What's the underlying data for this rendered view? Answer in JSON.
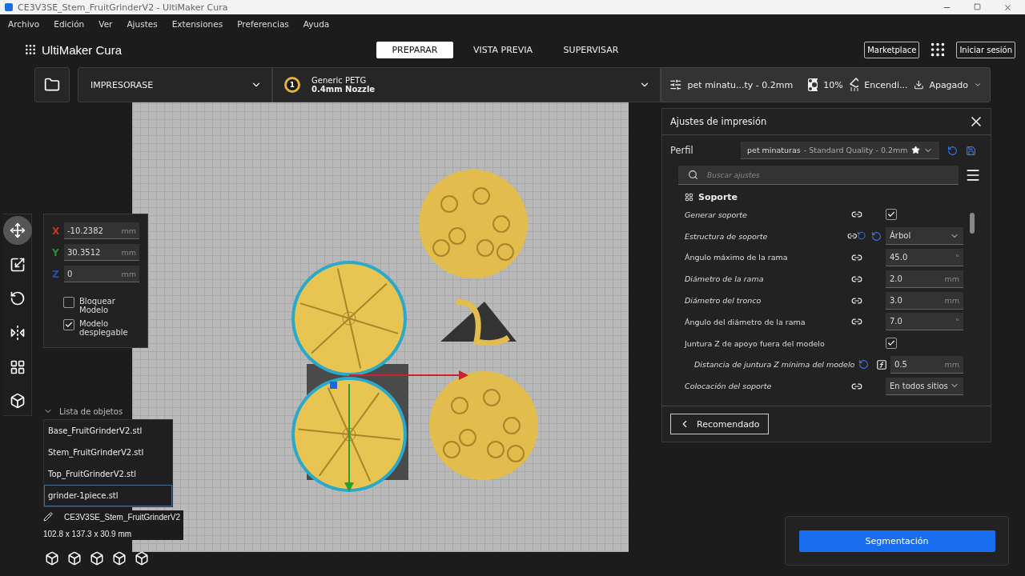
{
  "window": {
    "title": "CE3V3SE_Stem_FruitGrinderV2 - UltiMaker Cura"
  },
  "menu": [
    "Archivo",
    "Edición",
    "Ver",
    "Ajustes",
    "Extensiones",
    "Preferencias",
    "Ayuda"
  ],
  "header": {
    "logo": "UltiMaker Cura",
    "tabs": [
      {
        "label": "PREPARAR",
        "selected": true
      },
      {
        "label": "VISTA PREVIA",
        "selected": false
      },
      {
        "label": "SUPERVISAR",
        "selected": false
      }
    ],
    "marketplace": "Marketplace",
    "login": "Iniciar sesión"
  },
  "printer_bar": {
    "printer": "IMPRESORASE",
    "extruder": {
      "number": "1",
      "material": "Generic PETG",
      "nozzle": "0.4mm Nozzle"
    },
    "profile": "pet minatu...ty - 0.2mm",
    "infill": "10%",
    "support": "Encendi...",
    "adhesion": "Apagado"
  },
  "tools": [
    {
      "kind": "move",
      "selected": true
    },
    {
      "kind": "scale",
      "selected": false
    },
    {
      "kind": "rotate",
      "selected": false
    },
    {
      "kind": "mirror",
      "selected": false
    },
    {
      "kind": "per_model",
      "selected": false
    },
    {
      "kind": "support_blocker",
      "selected": false
    }
  ],
  "move_panel": {
    "fields": [
      {
        "axis": "X",
        "value": "-10.2382",
        "unit": "mm",
        "color": "#c0392b"
      },
      {
        "axis": "Y",
        "value": "30.3512",
        "unit": "mm",
        "color": "#2e8b3a"
      },
      {
        "axis": "Z",
        "value": "0",
        "unit": "mm",
        "color": "#2d4fa8"
      }
    ],
    "checkboxes": [
      {
        "label": "Bloquear Modelo",
        "checked": false
      },
      {
        "label": "Modelo desplegable",
        "checked": true
      }
    ]
  },
  "object_list": {
    "title": "Lista de objetos",
    "expanded": true,
    "items": [
      {
        "name": "Base_FruitGrinderV2.stl",
        "selected": false
      },
      {
        "name": "Stem_FruitGrinderV2.stl",
        "selected": false
      },
      {
        "name": "Top_FruitGrinderV2.stl",
        "selected": false
      },
      {
        "name": "grinder-1piece.stl",
        "selected": true
      }
    ]
  },
  "model_info": {
    "name": "CE3V3SE_Stem_FruitGrinderV2",
    "dimensions": "102.8 x 137.3 x 30.9 mm"
  },
  "settings_panel": {
    "title": "Ajustes de impresión",
    "profile_label": "Perfil",
    "profile_name": "pet minaturas",
    "profile_detail": "- Standard Quality - 0.2mm",
    "search_placeholder": "Buscar ajustes",
    "category": "Soporte",
    "settings": [
      {
        "label": "Generar soporte",
        "kind": "checkbox",
        "checked": true,
        "modified": true,
        "linked": true,
        "reset": false
      },
      {
        "label": "Estructura de soporte",
        "kind": "dropdown",
        "value": "Árbol",
        "modified": true,
        "linked": true,
        "reset": true
      },
      {
        "label": "Ángulo máximo de la rama",
        "kind": "number",
        "value": "45.0",
        "unit": "°",
        "modified": false,
        "linked": true,
        "reset": false
      },
      {
        "label": "Diámetro de la rama",
        "kind": "number",
        "value": "2.0",
        "unit": "mm",
        "modified": true,
        "linked": true,
        "reset": false
      },
      {
        "label": "Diámetro del tronco",
        "kind": "number",
        "value": "3.0",
        "unit": "mm",
        "modified": true,
        "linked": true,
        "reset": false
      },
      {
        "label": "Ángulo del diámetro de la rama",
        "kind": "number",
        "value": "7.0",
        "unit": "°",
        "modified": false,
        "linked": true,
        "reset": false
      },
      {
        "label": "Juntura Z de apoyo fuera del modelo",
        "kind": "checkbox",
        "checked": true,
        "modified": false,
        "linked": false,
        "reset": false,
        "children": [
          {
            "label": "Distancia de juntura Z mínima del modelo",
            "kind": "number",
            "value": "0.5",
            "unit": "mm",
            "modified": true,
            "linked": false,
            "reset": true,
            "formula": true
          }
        ]
      },
      {
        "label": "Colocación del soporte",
        "kind": "dropdown",
        "value": "En todos sitios",
        "modified": true,
        "linked": true,
        "reset": false
      }
    ],
    "footer_button": "Recomendado"
  },
  "slice_button": "Segmentación"
}
